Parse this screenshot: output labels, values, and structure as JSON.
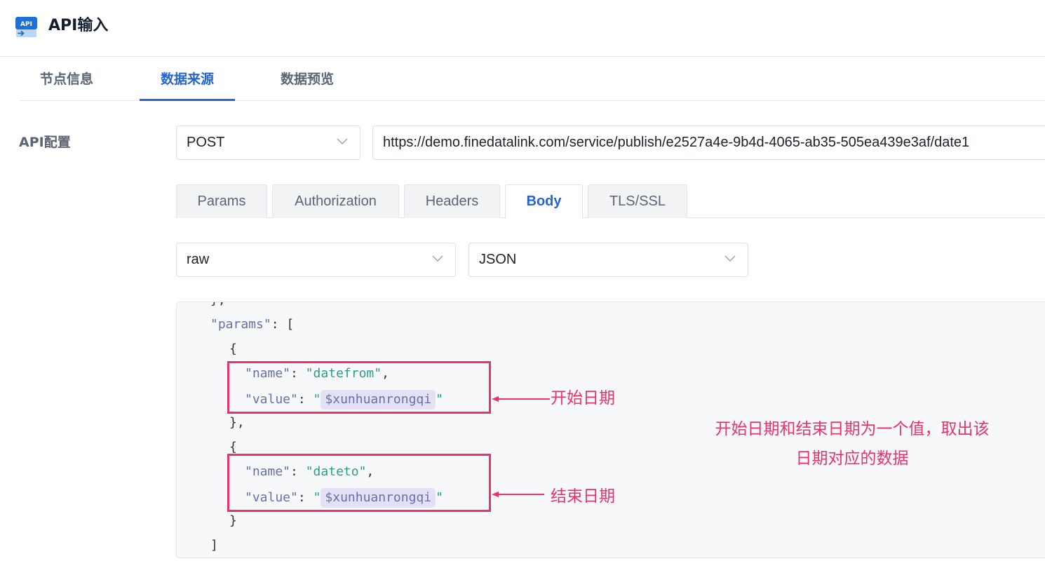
{
  "app": {
    "title": "API输入",
    "icon": "api-node-icon",
    "icon_text": "API"
  },
  "main_tabs": [
    {
      "label": "节点信息",
      "active": false
    },
    {
      "label": "数据来源",
      "active": true
    },
    {
      "label": "数据预览",
      "active": false
    }
  ],
  "api_config": {
    "label": "API配置",
    "method": "POST",
    "url": "https://demo.finedatalink.com/service/publish/e2527a4e-9b4d-4065-ab35-505ea439e3af/date1"
  },
  "sub_tabs": [
    {
      "label": "Params",
      "active": false
    },
    {
      "label": "Authorization",
      "active": false
    },
    {
      "label": "Headers",
      "active": false
    },
    {
      "label": "Body",
      "active": true
    },
    {
      "label": "TLS/SSL",
      "active": false
    }
  ],
  "body": {
    "mode": "raw",
    "format": "JSON"
  },
  "code": {
    "cut_line": "},",
    "params_key": "\"params\"",
    "params_open": ": [",
    "brace_open": "{",
    "brace_close_comma": "},",
    "brace_close": "}",
    "bracket_close": "]",
    "name_key": "\"name\"",
    "value_key": "\"value\"",
    "colon": ": ",
    "comma": ",",
    "quote": "\"",
    "first_name": "\"datefrom\"",
    "second_name": "\"dateto\"",
    "variable": "$xunhuanrongqi"
  },
  "annotations": {
    "start_label": "开始日期",
    "end_label": "结束日期",
    "note_line1": "开始日期和结束日期为一个值，取出该",
    "note_line2": "日期对应的数据"
  },
  "colors": {
    "accent": "#2464d6",
    "annotation": "#e8336b",
    "json_key": "#6a6fa7",
    "json_string": "#2e9d88",
    "variable_bg": "#e4e1f7"
  }
}
